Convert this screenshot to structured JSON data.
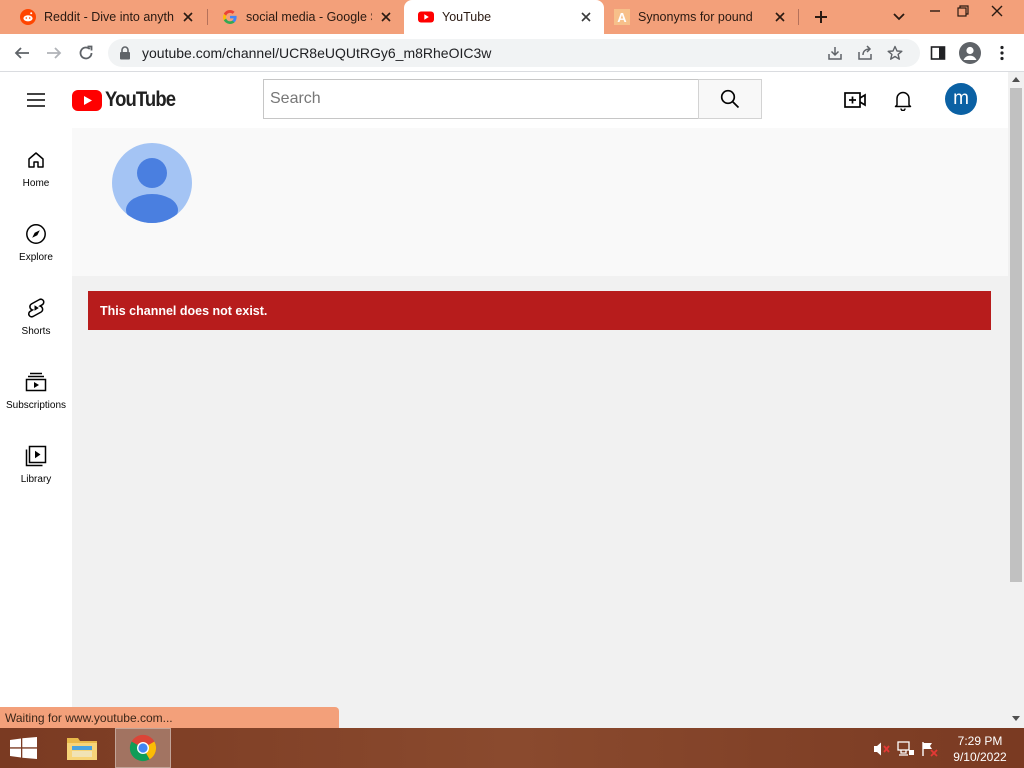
{
  "browser": {
    "tabs": [
      {
        "title": "Reddit - Dive into anything",
        "icon": "reddit-icon"
      },
      {
        "title": "social media - Google Search",
        "icon": "google-icon"
      },
      {
        "title": "YouTube",
        "icon": "youtube-icon",
        "active": true
      },
      {
        "title": "Synonyms for pound",
        "icon": "thesaurus-icon"
      }
    ],
    "url": "youtube.com/channel/UCR8eUQUtRGy6_m8RheOIC3w",
    "status_text": "Waiting for www.youtube.com..."
  },
  "youtube": {
    "logo_text": "YouTube",
    "search_placeholder": "Search",
    "account_initial": "m",
    "guide": [
      {
        "label": "Home",
        "icon": "home-icon"
      },
      {
        "label": "Explore",
        "icon": "compass-icon"
      },
      {
        "label": "Shorts",
        "icon": "shorts-icon"
      },
      {
        "label": "Subscriptions",
        "icon": "subscriptions-icon"
      },
      {
        "label": "Library",
        "icon": "library-icon"
      }
    ],
    "alert_message": "This channel does not exist."
  },
  "taskbar": {
    "time": "7:29 PM",
    "date": "9/10/2022"
  },
  "colors": {
    "alert": "#b71c1c",
    "youtube_red": "#ff0000",
    "chrome_frame": "#f3a07a",
    "avatar_blue": "#0b61a4"
  }
}
